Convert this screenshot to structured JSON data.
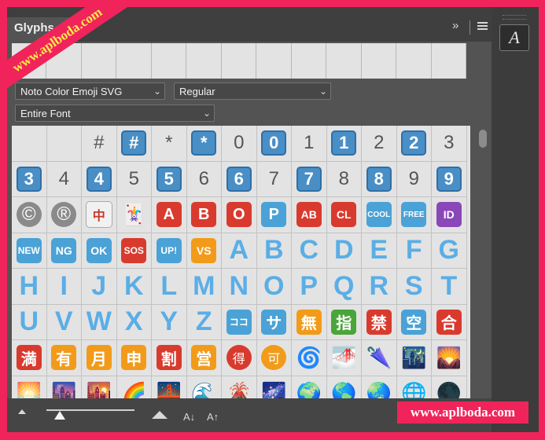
{
  "panel": {
    "title": "Glyphs",
    "collapse_icon": "double-chevron-right",
    "menu_icon": "hamburger"
  },
  "character_button": "A",
  "font_family": {
    "value": "Noto Color Emoji SVG",
    "chevron": "⌄"
  },
  "font_style": {
    "value": "Regular",
    "chevron": "⌄"
  },
  "show_filter": {
    "value": "Entire Font",
    "chevron": "⌄"
  },
  "recent_glyph_count": 13,
  "glyph_rows": [
    [
      "",
      "",
      "#",
      "#",
      "*",
      "*",
      "0",
      "0",
      "1",
      "1",
      "2",
      "2",
      "3"
    ],
    [
      "3",
      "4",
      "4",
      "5",
      "5",
      "6",
      "6",
      "7",
      "7",
      "8",
      "8",
      "9",
      "9"
    ],
    [
      "©",
      "®",
      "中",
      "🃏",
      "A",
      "B",
      "O",
      "P",
      "AB",
      "CL",
      "COOL",
      "FREE",
      "ID"
    ],
    [
      "NEW",
      "NG",
      "OK",
      "SOS",
      "UP!",
      "VS",
      "A",
      "B",
      "C",
      "D",
      "E",
      "F",
      "G"
    ],
    [
      "H",
      "I",
      "J",
      "K",
      "L",
      "M",
      "N",
      "O",
      "P",
      "Q",
      "R",
      "S",
      "T"
    ],
    [
      "U",
      "V",
      "W",
      "X",
      "Y",
      "Z",
      "ココ",
      "サ",
      "無",
      "指",
      "禁",
      "空",
      "合"
    ],
    [
      "満",
      "有",
      "月",
      "申",
      "割",
      "営",
      "得",
      "可",
      "🌀",
      "🌁",
      "🌂",
      "🌃",
      "🌄"
    ],
    [
      "🌅",
      "🌆",
      "🌇",
      "🌈",
      "🌉",
      "🌊",
      "🌋",
      "🌌",
      "🌍",
      "🌎",
      "🌏",
      "🌐",
      "🌑"
    ]
  ],
  "glyph_styles": [
    [
      "",
      "",
      "plain",
      "key",
      "plain",
      "key",
      "plain",
      "key",
      "plain",
      "key",
      "plain",
      "key",
      "plain"
    ],
    [
      "key",
      "plain",
      "key",
      "plain",
      "key",
      "plain",
      "key",
      "plain",
      "key",
      "plain",
      "key",
      "plain",
      "key"
    ],
    [
      "circle-gray",
      "circle-gray",
      "tile",
      "emoji",
      "red",
      "red",
      "red",
      "blu",
      "red",
      "red",
      "blu",
      "blu",
      "pur"
    ],
    [
      "blu",
      "blu",
      "blu",
      "red",
      "blu",
      "orng",
      "letter",
      "letter",
      "letter",
      "letter",
      "letter",
      "letter",
      "letter"
    ],
    [
      "letter",
      "letter",
      "letter",
      "letter",
      "letter",
      "letter",
      "letter",
      "letter",
      "letter",
      "letter",
      "letter",
      "letter",
      "letter"
    ],
    [
      "letter",
      "letter",
      "letter",
      "letter",
      "letter",
      "letter",
      "blu",
      "blu",
      "orng",
      "grn",
      "red",
      "blu",
      "red"
    ],
    [
      "red",
      "orng",
      "orng",
      "orng",
      "red",
      "orng",
      "circle-red",
      "circle-orng",
      "emoji",
      "emoji",
      "emoji",
      "emoji",
      "emoji"
    ],
    [
      "emoji",
      "emoji",
      "emoji",
      "emoji",
      "emoji",
      "emoji",
      "emoji",
      "emoji",
      "emoji",
      "emoji",
      "emoji",
      "emoji",
      "emoji"
    ]
  ],
  "size_controls": {
    "smaller_icon": "small-mountain",
    "larger_icon": "large-mountain",
    "decrease_font_label": "A↓",
    "increase_font_label": "A↑",
    "slider_value_percent": 15
  },
  "watermarks": {
    "ribbon": "www.aplboda.com",
    "corner": "www.aplboda.com"
  }
}
